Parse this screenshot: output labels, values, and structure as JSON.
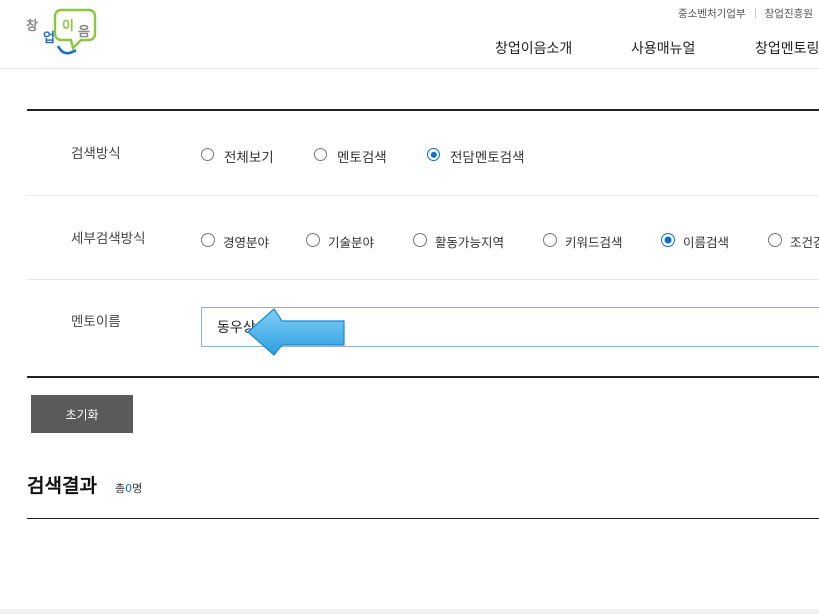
{
  "header": {
    "logo_text": "창업이음",
    "util_links": [
      "중소벤처기업부",
      "창업진흥원"
    ],
    "nav": [
      "창업이음소개",
      "사용매뉴얼",
      "창업멘토링"
    ]
  },
  "search": {
    "method": {
      "label": "검색방식",
      "options": [
        {
          "label": "전체보기",
          "selected": false
        },
        {
          "label": "멘토검색",
          "selected": false
        },
        {
          "label": "전담멘토검색",
          "selected": true
        }
      ]
    },
    "detail_method": {
      "label": "세부검색방식",
      "options": [
        {
          "label": "경영분야",
          "selected": false
        },
        {
          "label": "기술분야",
          "selected": false
        },
        {
          "label": "활동가능지역",
          "selected": false
        },
        {
          "label": "키워드검색",
          "selected": false
        },
        {
          "label": "이름검색",
          "selected": true
        },
        {
          "label": "조건검색",
          "selected": false
        }
      ]
    },
    "mentor_name": {
      "label": "멘토이름",
      "value": "동우상"
    },
    "reset_label": "초기화"
  },
  "results": {
    "title": "검색결과",
    "count_prefix": "총",
    "count": "0",
    "count_suffix": "명"
  },
  "colors": {
    "accent": "#0a6ed1",
    "arrow": "#4fb3ea",
    "button": "#5a5a5a"
  }
}
